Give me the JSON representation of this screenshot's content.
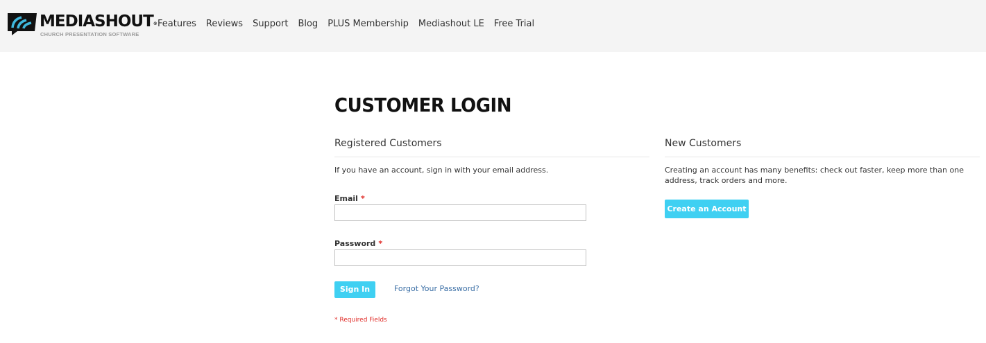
{
  "header": {
    "logo": {
      "wordmark": "MEDIASHOUT",
      "registered": "®",
      "tagline": "CHURCH PRESENTATION SOFTWARE"
    },
    "nav": [
      {
        "label": "Features"
      },
      {
        "label": "Reviews"
      },
      {
        "label": "Support"
      },
      {
        "label": "Blog"
      },
      {
        "label": "PLUS Membership"
      },
      {
        "label": "Mediashout LE"
      },
      {
        "label": "Free Trial"
      }
    ]
  },
  "main": {
    "title": "CUSTOMER LOGIN",
    "registered": {
      "title": "Registered Customers",
      "intro": "If you have an account, sign in with your email address.",
      "email_label": "Email",
      "email_value": "",
      "password_label": "Password",
      "password_value": "",
      "required_marker": "*",
      "signin_label": "Sign In",
      "forgot_label": "Forgot Your Password?",
      "required_note": "* Required Fields"
    },
    "new_customers": {
      "title": "New Customers",
      "intro": "Creating an account has many benefits: check out faster, keep more than one address, track orders and more.",
      "create_label": "Create an Account"
    }
  },
  "colors": {
    "accent": "#3fd0f2",
    "required": "#e02b27",
    "link": "#3a6ea5",
    "header_bg": "#f4f4f4"
  }
}
